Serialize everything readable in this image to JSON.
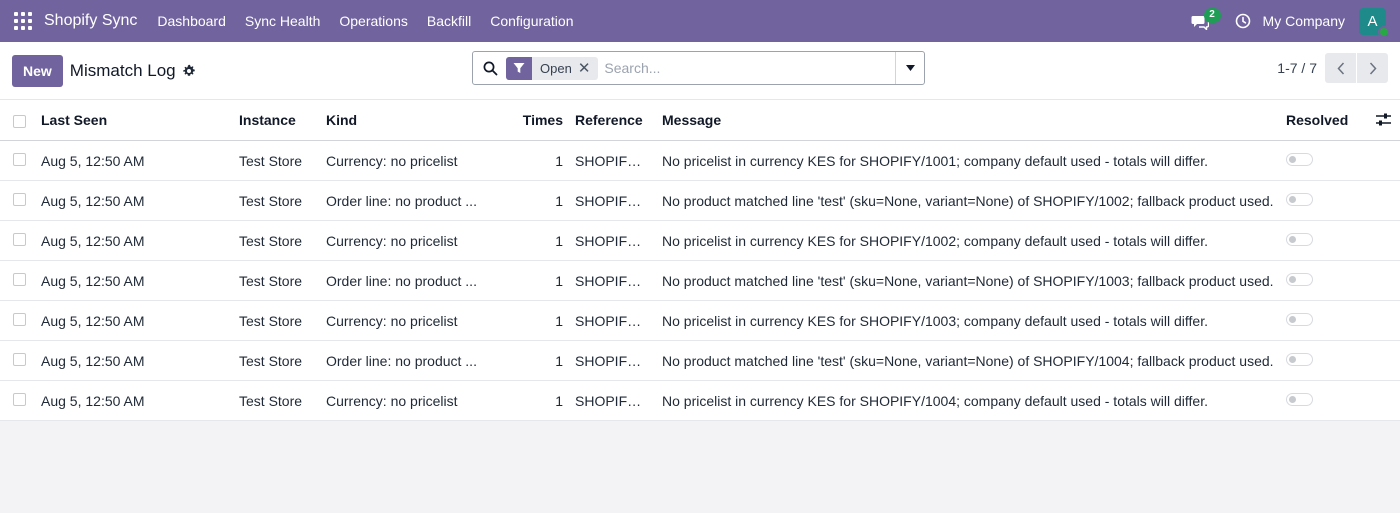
{
  "navbar": {
    "app_name": "Shopify Sync",
    "menu": [
      "Dashboard",
      "Sync Health",
      "Operations",
      "Backfill",
      "Configuration"
    ],
    "messages_count": "2",
    "company": "My Company",
    "avatar_letter": "A"
  },
  "control": {
    "new_label": "New",
    "title": "Mismatch Log",
    "filter_facet": "Open",
    "search_placeholder": "Search...",
    "pager": "1-7 / 7"
  },
  "table": {
    "columns": {
      "last_seen": "Last Seen",
      "instance": "Instance",
      "kind": "Kind",
      "times": "Times",
      "reference": "Reference",
      "message": "Message",
      "resolved": "Resolved"
    },
    "rows": [
      {
        "last_seen": "Aug 5, 12:50 AM",
        "instance": "Test Store",
        "kind": "Currency: no pricelist",
        "times": "1",
        "reference": "SHOPIFY/...",
        "message": "No pricelist in currency KES for SHOPIFY/1001; company default used - totals will differ.",
        "resolved": false
      },
      {
        "last_seen": "Aug 5, 12:50 AM",
        "instance": "Test Store",
        "kind": "Order line: no product ...",
        "times": "1",
        "reference": "SHOPIFY/...",
        "message": "No product matched line 'test' (sku=None, variant=None) of SHOPIFY/1002; fallback product used.",
        "resolved": false
      },
      {
        "last_seen": "Aug 5, 12:50 AM",
        "instance": "Test Store",
        "kind": "Currency: no pricelist",
        "times": "1",
        "reference": "SHOPIFY/...",
        "message": "No pricelist in currency KES for SHOPIFY/1002; company default used - totals will differ.",
        "resolved": false
      },
      {
        "last_seen": "Aug 5, 12:50 AM",
        "instance": "Test Store",
        "kind": "Order line: no product ...",
        "times": "1",
        "reference": "SHOPIFY/...",
        "message": "No product matched line 'test' (sku=None, variant=None) of SHOPIFY/1003; fallback product used.",
        "resolved": false
      },
      {
        "last_seen": "Aug 5, 12:50 AM",
        "instance": "Test Store",
        "kind": "Currency: no pricelist",
        "times": "1",
        "reference": "SHOPIFY/...",
        "message": "No pricelist in currency KES for SHOPIFY/1003; company default used - totals will differ.",
        "resolved": false
      },
      {
        "last_seen": "Aug 5, 12:50 AM",
        "instance": "Test Store",
        "kind": "Order line: no product ...",
        "times": "1",
        "reference": "SHOPIFY/...",
        "message": "No product matched line 'test' (sku=None, variant=None) of SHOPIFY/1004; fallback product used.",
        "resolved": false
      },
      {
        "last_seen": "Aug 5, 12:50 AM",
        "instance": "Test Store",
        "kind": "Currency: no pricelist",
        "times": "1",
        "reference": "SHOPIFY/...",
        "message": "No pricelist in currency KES for SHOPIFY/1004; company default used - totals will differ.",
        "resolved": false
      }
    ]
  },
  "icons": {
    "apps": "apps-grid-icon",
    "chat": "chat-icon",
    "clock": "clock-icon",
    "gear": "gear-icon",
    "search": "search-icon",
    "filter": "filter-icon",
    "remove_facet": "close-icon",
    "dropdown": "caret-down-icon",
    "prev": "chevron-left-icon",
    "next": "chevron-right-icon",
    "optional_columns": "sliders-icon"
  },
  "colors": {
    "brand": "#71639e",
    "badge": "#1f9d55",
    "avatar": "#1f8a8a"
  }
}
